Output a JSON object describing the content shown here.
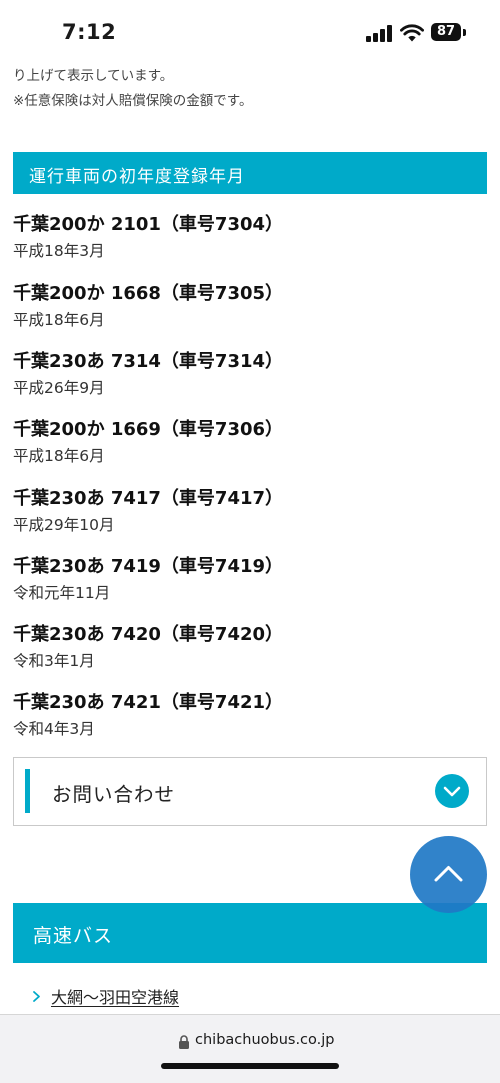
{
  "status_bar": {
    "time": "7:12",
    "battery": "87"
  },
  "notes": [
    "り上げて表示しています。",
    "※任意保険は対人賠償保険の金額です。"
  ],
  "section": {
    "title": "運行車両の初年度登録年月"
  },
  "vehicles": [
    {
      "plate": "千葉200か 2101（車号7304）",
      "registered": "平成18年3月"
    },
    {
      "plate": "千葉200か 1668（車号7305）",
      "registered": "平成18年6月"
    },
    {
      "plate": "千葉230あ 7314（車号7314）",
      "registered": "平成26年9月"
    },
    {
      "plate": "千葉200か 1669（車号7306）",
      "registered": "平成18年6月"
    },
    {
      "plate": "千葉230あ 7417（車号7417）",
      "registered": "平成29年10月"
    },
    {
      "plate": "千葉230あ 7419（車号7419）",
      "registered": "令和元年11月"
    },
    {
      "plate": "千葉230あ 7420（車号7420）",
      "registered": "令和3年1月"
    },
    {
      "plate": "千葉230あ 7421（車号7421）",
      "registered": "令和4年3月"
    }
  ],
  "contact": {
    "label": "お問い合わせ",
    "icon": "chevron-down-icon"
  },
  "scroll_top": {
    "icon": "chevron-up-icon"
  },
  "highway": {
    "title": "高速バス",
    "links": [
      {
        "label": "大網〜羽田空港線",
        "icon": "chevron-right-icon"
      }
    ]
  },
  "browser": {
    "url": "chibachuobus.co.jp",
    "icon": "lock-icon"
  },
  "colors": {
    "accent": "#00aac9",
    "scroll_button": "#1f78c6"
  }
}
